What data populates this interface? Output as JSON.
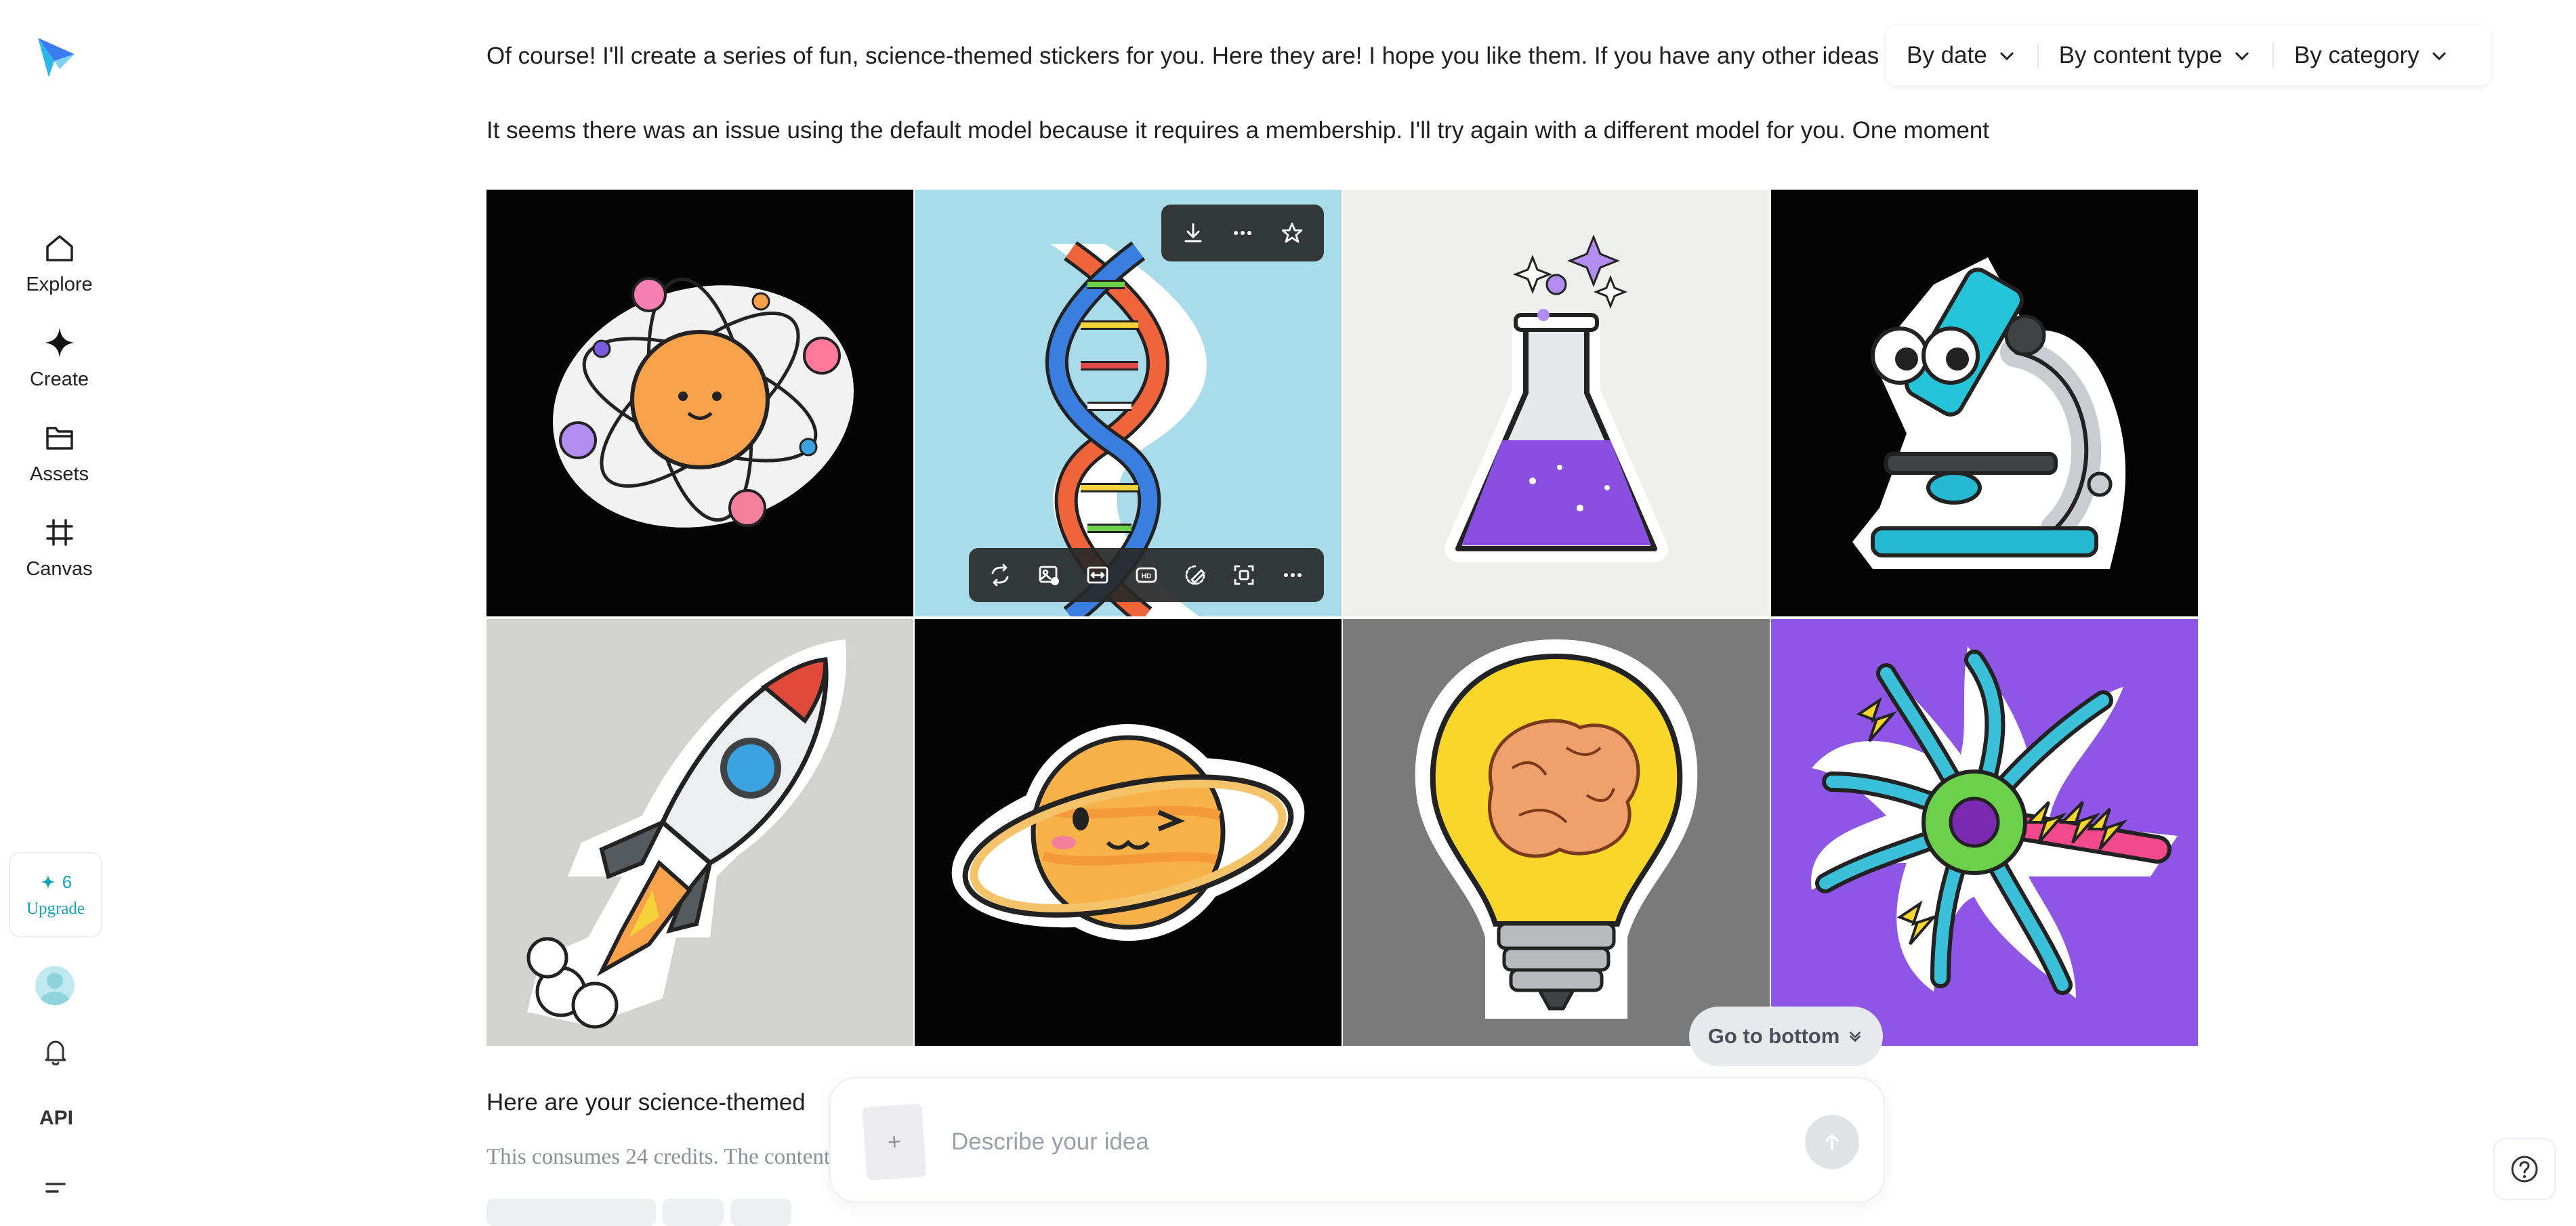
{
  "sidebar": {
    "logo_icon": "paper-plane-logo",
    "items": [
      {
        "label": "Explore",
        "icon": "home-icon"
      },
      {
        "label": "Create",
        "icon": "sparkle-icon"
      },
      {
        "label": "Assets",
        "icon": "folder-icon"
      },
      {
        "label": "Canvas",
        "icon": "hash-icon"
      }
    ],
    "credits": "6",
    "upgrade_label": "Upgrade",
    "api_label": "API"
  },
  "filters": {
    "by_date": "By date",
    "by_content_type": "By content type",
    "by_category": "By category"
  },
  "messages": {
    "intro": "Of course! I'll create a series of fun, science-themed stickers for you. Here they are! I hope you like them. If you have any other ideas",
    "retry": "It seems there was an issue using the default model because it requires a membership. I'll try again with a different model for you. One moment",
    "result": "Here are your science-themed stickers",
    "credits_note": "This consumes 24 credits. The content"
  },
  "stickers": [
    {
      "subject": "atom",
      "bg": "#050505"
    },
    {
      "subject": "dna",
      "bg": "#a8dcea"
    },
    {
      "subject": "flask",
      "bg": "#efefee"
    },
    {
      "subject": "microscope",
      "bg": "#040404"
    },
    {
      "subject": "rocket",
      "bg": "#d2d2d1"
    },
    {
      "subject": "planet",
      "bg": "#040404"
    },
    {
      "subject": "brain-bulb",
      "bg": "#7a7a7a"
    },
    {
      "subject": "neuron",
      "bg": "#8e55e6"
    }
  ],
  "image_top_toolbar": [
    "download-icon",
    "more-icon",
    "star-icon"
  ],
  "image_bottom_toolbar": [
    "regenerate-icon",
    "image-edit-icon",
    "expand-icon",
    "hd-icon",
    "eraser-icon",
    "crop-icon",
    "more-icon"
  ],
  "go_to_bottom_label": "Go to bottom",
  "prompt": {
    "placeholder": "Describe your idea",
    "attach_label": "+"
  },
  "colors": {
    "accent": "#11a3b8",
    "text": "#1f1f1f",
    "muted": "#8a8f98"
  }
}
